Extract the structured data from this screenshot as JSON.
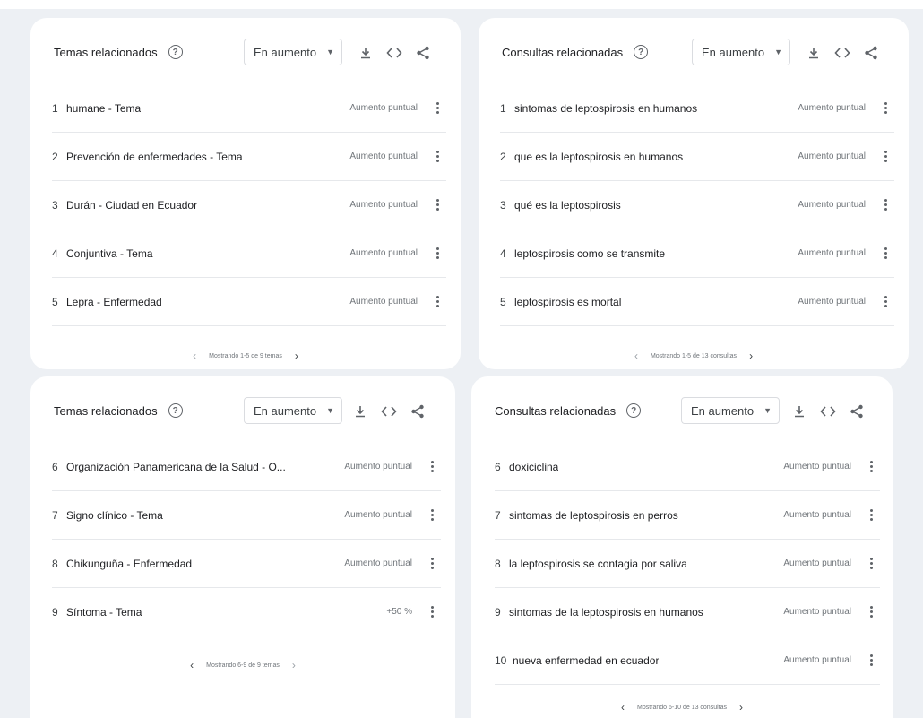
{
  "panels": [
    {
      "title": "Temas relacionados",
      "select": "En aumento",
      "rows": [
        {
          "idx": "1",
          "label": "humane - Tema",
          "value": "Aumento puntual"
        },
        {
          "idx": "2",
          "label": "Prevención de enfermedades - Tema",
          "value": "Aumento puntual"
        },
        {
          "idx": "3",
          "label": "Durán - Ciudad en Ecuador",
          "value": "Aumento puntual"
        },
        {
          "idx": "4",
          "label": "Conjuntiva - Tema",
          "value": "Aumento puntual"
        },
        {
          "idx": "5",
          "label": "Lepra - Enfermedad",
          "value": "Aumento puntual"
        }
      ],
      "pager": "Mostrando 1-5 de 9 temas"
    },
    {
      "title": "Consultas relacionadas",
      "select": "En aumento",
      "rows": [
        {
          "idx": "1",
          "label": "sintomas de leptospirosis en humanos",
          "value": "Aumento puntual"
        },
        {
          "idx": "2",
          "label": "que es la leptospirosis en humanos",
          "value": "Aumento puntual"
        },
        {
          "idx": "3",
          "label": "qué es la leptospirosis",
          "value": "Aumento puntual"
        },
        {
          "idx": "4",
          "label": "leptospirosis como se transmite",
          "value": "Aumento puntual"
        },
        {
          "idx": "5",
          "label": "leptospirosis es mortal",
          "value": "Aumento puntual"
        }
      ],
      "pager": "Mostrando 1-5 de 13 consultas"
    },
    {
      "title": "Temas relacionados",
      "select": "En aumento",
      "rows": [
        {
          "idx": "6",
          "label": "Organización Panamericana de la Salud - O...",
          "value": "Aumento puntual"
        },
        {
          "idx": "7",
          "label": "Signo clínico - Tema",
          "value": "Aumento puntual"
        },
        {
          "idx": "8",
          "label": "Chikunguña - Enfermedad",
          "value": "Aumento puntual"
        },
        {
          "idx": "9",
          "label": "Síntoma - Tema",
          "value": "+50 %"
        }
      ],
      "pager": "Mostrando 6-9 de 9 temas"
    },
    {
      "title": "Consultas relacionadas",
      "select": "En aumento",
      "rows": [
        {
          "idx": "6",
          "label": "doxiciclina",
          "value": "Aumento puntual"
        },
        {
          "idx": "7",
          "label": "sintomas de leptospirosis en perros",
          "value": "Aumento puntual"
        },
        {
          "idx": "8",
          "label": "la leptospirosis se contagia por saliva",
          "value": "Aumento puntual"
        },
        {
          "idx": "9",
          "label": "sintomas de la leptospirosis en humanos",
          "value": "Aumento puntual"
        },
        {
          "idx": "10",
          "label": "nueva enfermedad en ecuador",
          "value": "Aumento puntual"
        }
      ],
      "pager": "Mostrando 6-10 de 13 consultas"
    }
  ],
  "icons": {
    "help": "?",
    "caret": "▼",
    "download": "download-icon",
    "embed": "embed-code-icon",
    "share": "share-icon",
    "prev": "‹",
    "next": "›"
  },
  "colors": {
    "background": "#edf0f4",
    "card": "#ffffff",
    "divider": "#e6e8eb",
    "muted_text": "#70757a"
  }
}
